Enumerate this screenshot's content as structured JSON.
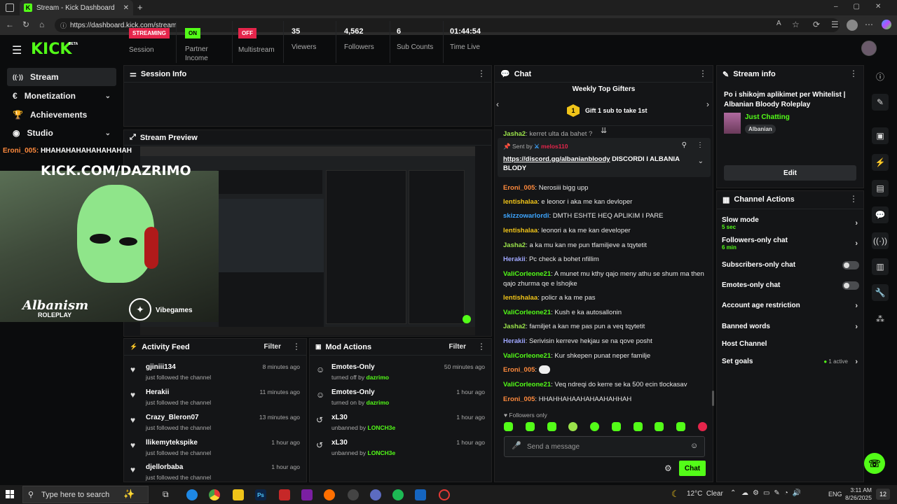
{
  "browser": {
    "tab_title": "Stream - Kick Dashboard",
    "url": "https://dashboard.kick.com/stream"
  },
  "app": {
    "logo": "KICK",
    "badge": "BETA"
  },
  "sidebar": {
    "items": [
      {
        "label": "Stream",
        "icon": "broadcast-icon"
      },
      {
        "label": "Monetization",
        "icon": "dollar-icon"
      },
      {
        "label": "Achievements",
        "icon": "trophy-icon"
      },
      {
        "label": "Studio",
        "icon": "studio-icon"
      }
    ]
  },
  "session": {
    "title": "Session Info",
    "stats": [
      {
        "badge": "STREAMING",
        "label": "Session"
      },
      {
        "badge": "ON",
        "label": "Partner Income"
      },
      {
        "badge": "OFF",
        "label": "Multistream"
      },
      {
        "value": "35",
        "label": "Viewers"
      },
      {
        "value": "4,562",
        "label": "Followers"
      },
      {
        "value": "6",
        "label": "Sub Counts"
      },
      {
        "value": "01:44:54",
        "label": "Time Live"
      }
    ]
  },
  "preview": {
    "title": "Stream Preview",
    "overlay_chat": "Eroni_005: HHAHAHAHAHAHAHAHAH",
    "overlay_chat_user": "Eroni_005",
    "overlay_chat_text": "HHAHAHAHAHAHAHAHAH",
    "overlay_url": "KICK.COM/DAZRIMO",
    "overlay_brand": "Albanism",
    "overlay_brand_sub": "ROLEPLAY",
    "overlay_sponsor": "Vibegames"
  },
  "activity": {
    "title": "Activity Feed",
    "filter": "Filter",
    "items": [
      {
        "name": "gjiniii134",
        "desc": "just followed the channel",
        "time": "8 minutes ago"
      },
      {
        "name": "Herakii",
        "desc": "just followed the channel",
        "time": "11 minutes ago"
      },
      {
        "name": "Crazy_Bleron07",
        "desc": "just followed the channel",
        "time": "13 minutes ago"
      },
      {
        "name": "llikemytekspike",
        "desc": "just followed the channel",
        "time": "1 hour ago"
      },
      {
        "name": "djellorbaba",
        "desc": "just followed the channel",
        "time": "1 hour ago"
      }
    ]
  },
  "mod": {
    "title": "Mod Actions",
    "filter": "Filter",
    "items": [
      {
        "name": "Emotes-Only",
        "prefix": "turned off by",
        "by": "dazrimo",
        "time": "50 minutes ago",
        "icon": "emote-icon"
      },
      {
        "name": "Emotes-Only",
        "prefix": "turned on by",
        "by": "dazrimo",
        "time": "1 hour ago",
        "icon": "emote-icon"
      },
      {
        "name": "xL30",
        "prefix": "unbanned by",
        "by": "LONCH3e",
        "time": "1 hour ago",
        "icon": "undo-icon"
      },
      {
        "name": "xL30",
        "prefix": "unbanned by",
        "by": "LONCH3e",
        "time": "1 hour ago",
        "icon": "undo-icon"
      }
    ]
  },
  "chat": {
    "title": "Chat",
    "gifters_title": "Weekly Top Gifters",
    "gifters_rank": "1",
    "gifters_text": "Gift 1 sub to take 1st",
    "truncated_user": "Jasha2",
    "truncated_text": "kerret ulta da bahet ?",
    "pinned_prefix": "Sent by",
    "pinned_user": "melos110",
    "pinned_link": "https://discord.gg/albanianbloody",
    "pinned_text": "DISCORDI I ALBANIA BLODY",
    "messages": [
      {
        "user": "Eroni_005",
        "color": "#ff8a3d",
        "text": "Nerosiii bigg upp"
      },
      {
        "user": "lentishalaa",
        "color": "#f0c419",
        "text": "e leonor i aka me kan devloper"
      },
      {
        "user": "skizzowarlordi",
        "color": "#3da5ff",
        "text": "DMTH ESHTE HEQ APLIKIM I PARE"
      },
      {
        "user": "lentishalaa",
        "color": "#f0c419",
        "text": "leonori a ka me kan developer"
      },
      {
        "user": "Jasha2",
        "color": "#9be34b",
        "text": "a ka mu kan me pun tfamiljeve a tqytetit"
      },
      {
        "user": "Herakii",
        "color": "#a0a7ff",
        "text": "Pc check a bohet nfillim"
      },
      {
        "user": "ValiCorleone21",
        "color": "#53fc18",
        "text": "A munet mu kthy qajo meny athu se shum ma then qajo zhurma qe e lshojke"
      },
      {
        "user": "lentishalaa",
        "color": "#f0c419",
        "text": "policr a ka me pas"
      },
      {
        "user": "ValiCorleone21",
        "color": "#53fc18",
        "text": "Kush e ka autosallonin"
      },
      {
        "user": "Jasha2",
        "color": "#9be34b",
        "text": "familjet a kan me pas pun a veq tqytetit"
      },
      {
        "user": "Herakii",
        "color": "#a0a7ff",
        "text": "Serivisin kerreve hekjau se na qove posht"
      },
      {
        "user": "ValiCorleone21",
        "color": "#53fc18",
        "text": "Kur shkepen punat neper familje"
      },
      {
        "user": "Eroni_005",
        "color": "#ff8a3d",
        "text": ""
      },
      {
        "user": "ValiCorleone21",
        "color": "#53fc18",
        "text": "Veq ndreqi do kerre se ka 500 ecin tlockasav"
      },
      {
        "user": "Eroni_005",
        "color": "#ff8a3d",
        "text": "HHAHHAHAAHAHAAHAHHAH"
      }
    ],
    "mode": "Followers only",
    "placeholder": "Send a message",
    "send": "Chat"
  },
  "stream_info": {
    "title": "Stream info",
    "stream_title": "Po i shikojm aplikimet per Whitelist | Albanian Bloody Roleplay",
    "category": "Just Chatting",
    "tag": "Albanian",
    "edit": "Edit"
  },
  "channel_actions": {
    "title": "Channel Actions",
    "items": [
      {
        "label": "Slow mode",
        "sub": "5 sec",
        "control": "arrow"
      },
      {
        "label": "Followers-only chat",
        "sub": "6 min",
        "control": "arrow"
      },
      {
        "label": "Subscribers-only chat",
        "sub": "",
        "control": "toggle"
      },
      {
        "label": "Emotes-only chat",
        "sub": "",
        "control": "toggle"
      },
      {
        "label": "Account age restriction",
        "sub": "",
        "control": "arrow"
      },
      {
        "label": "Banned words",
        "sub": "",
        "control": "arrow"
      },
      {
        "label": "Host Channel",
        "sub": "",
        "control": "none"
      },
      {
        "label": "Set goals",
        "sub": "",
        "control": "arrow",
        "extra": "1 active"
      }
    ]
  },
  "taskbar": {
    "search_placeholder": "Type here to search",
    "weather": "12°C  Clear",
    "lang": "ENG",
    "time": "3:11 AM",
    "date": "8/26/2025",
    "notifications": "12"
  },
  "colors": {
    "accent": "#53fc18",
    "live": "#e5254b",
    "panel": "#141517"
  }
}
